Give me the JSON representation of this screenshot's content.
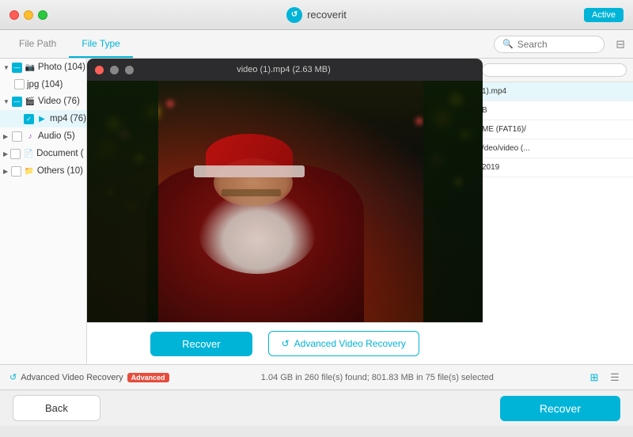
{
  "titlebar": {
    "title": "recoverit",
    "active_label": "Active"
  },
  "tabs": {
    "file_path": "File Path",
    "file_type": "File Type",
    "search_placeholder": "Search"
  },
  "sidebar": {
    "items": [
      {
        "id": "photo",
        "label": "Photo (104)",
        "icon": "📷",
        "checked": "partial",
        "expanded": true
      },
      {
        "id": "jpg",
        "label": "jpg (104)",
        "indent": 1,
        "checked": false
      },
      {
        "id": "video",
        "label": "Video (76)",
        "icon": "🎬",
        "checked": "partial",
        "expanded": true
      },
      {
        "id": "mp4",
        "label": "mp4 (76)",
        "indent": 1,
        "checked": true
      },
      {
        "id": "audio",
        "label": "Audio (5)",
        "icon": "🎵",
        "checked": false,
        "expanded": false
      },
      {
        "id": "document",
        "label": "Document (",
        "icon": "📄",
        "checked": false,
        "expanded": false
      },
      {
        "id": "others",
        "label": "Others (10)",
        "icon": "📁",
        "checked": false,
        "expanded": false
      }
    ]
  },
  "preview_modal": {
    "title": "video (1).mp4 (2.63 MB)",
    "recover_label": "Recover",
    "adv_recovery_label": "Advanced Video Recovery"
  },
  "file_list": {
    "items": [
      {
        "name": "1).mp4"
      },
      {
        "name": "B"
      },
      {
        "name": "ME (FAT16)/"
      },
      {
        "name": "/deo/video (...)"
      },
      {
        "name": "2019"
      }
    ]
  },
  "status_bar": {
    "adv_video": "Advanced Video Recovery",
    "advanced_badge": "Advanced",
    "info": "1.04 GB in 260 file(s) found; 801.83 MB in 75 file(s) selected"
  },
  "bottom_bar": {
    "back_label": "Back",
    "recover_label": "Recover"
  }
}
